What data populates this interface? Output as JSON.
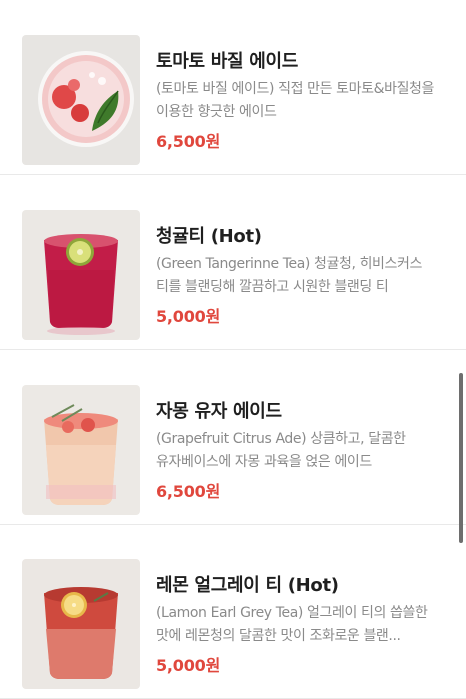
{
  "menu": {
    "items": [
      {
        "name": "토마토 바질 에이드",
        "description": "(토마토 바질 에이드) 직접 만든 토마토&바질청을 이용한 향긋한 에이드",
        "price": "6,500원"
      },
      {
        "name": "청귤티 (Hot)",
        "description": "(Green Tangerinne Tea) 청귤청, 히비스커스 티를 블랜딩해 깔끔하고 시원한 블랜딩 티",
        "price": "5,000원"
      },
      {
        "name": "자몽 유자 에이드",
        "description": "(Grapefruit Citrus Ade) 상큼하고, 달콤한 유자베이스에 자몽 과육을 얹은 에이드",
        "price": "6,500원"
      },
      {
        "name": "레몬 얼그레이 티 (Hot)",
        "description": "(Lamon Earl Grey Tea) 얼그레이 티의 씁쓸한 맛에 레몬청의 달콤한 맛이 조화로운 블랜...",
        "price": "5,000원"
      }
    ]
  },
  "colors": {
    "price": "#e0473d",
    "title": "#1f1f1f",
    "description": "#8a8a8a",
    "divider": "#e9e9e9"
  }
}
